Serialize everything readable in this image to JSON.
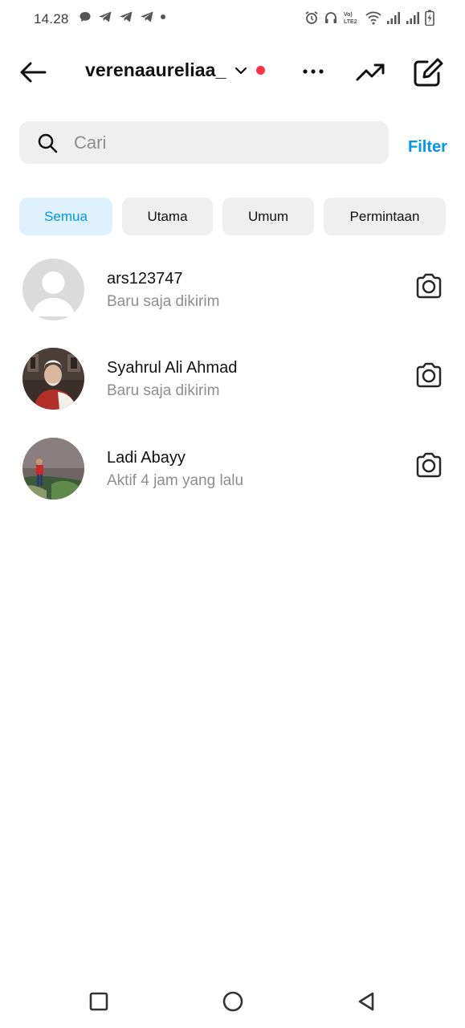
{
  "status_bar": {
    "time": "14.28",
    "left_icons": [
      "chat-bubble-icon",
      "telegram-icon",
      "telegram-icon",
      "telegram-icon",
      "dot-icon"
    ],
    "right_icons": [
      "alarm-icon",
      "headphones-icon",
      "volte-icon",
      "wifi-icon",
      "signal-icon",
      "signal-icon",
      "battery-charging-icon"
    ],
    "volte_text": "Vo) LTE2"
  },
  "header": {
    "account_name": "verenaaureliaa_",
    "notification_color": "#ff3040",
    "icons": [
      "back-arrow-icon",
      "chevron-down-icon",
      "more-icon",
      "trending-icon",
      "compose-icon"
    ]
  },
  "search": {
    "placeholder": "Cari",
    "value": "",
    "filter_label": "Filter"
  },
  "tabs": [
    {
      "label": "Semua",
      "active": true
    },
    {
      "label": "Utama",
      "active": false
    },
    {
      "label": "Umum",
      "active": false
    },
    {
      "label": "Permintaan",
      "active": false
    }
  ],
  "threads": [
    {
      "name": "ars123747",
      "subtitle": "Baru saja dikirim",
      "avatar": "default-avatar"
    },
    {
      "name": "Syahrul Ali Ahmad",
      "subtitle": "Baru saja dikirim",
      "avatar": "photo-avatar"
    },
    {
      "name": "Ladi Abayy",
      "subtitle": "Aktif 4 jam yang lalu",
      "avatar": "photo-avatar"
    }
  ],
  "colors": {
    "accent": "#0095f6",
    "chip_active_bg": "#dff1fd",
    "chip_bg": "#efefef",
    "secondary_text": "#8e8e8e"
  },
  "nav_bar": [
    "recents-square-icon",
    "home-circle-icon",
    "back-triangle-icon"
  ]
}
